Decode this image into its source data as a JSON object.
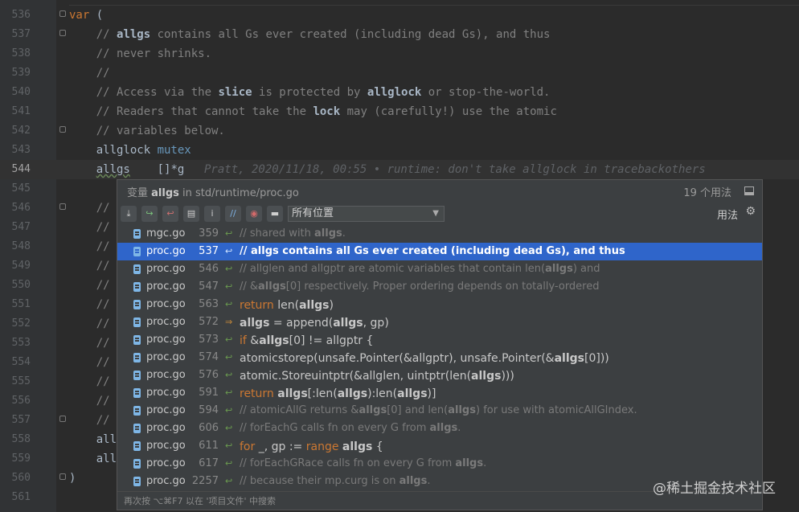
{
  "editor": {
    "lines": [
      {
        "n": "536",
        "code": "var ("
      },
      {
        "n": "537",
        "code": "    // allgs contains all Gs ever created (including dead Gs), and thus"
      },
      {
        "n": "538",
        "code": "    // never shrinks."
      },
      {
        "n": "539",
        "code": "    //"
      },
      {
        "n": "540",
        "code": "    // Access via the slice is protected by allglock or stop-the-world."
      },
      {
        "n": "541",
        "code": "    // Readers that cannot take the lock may (carefully!) use the atomic"
      },
      {
        "n": "542",
        "code": "    // variables below."
      },
      {
        "n": "543",
        "code": "    allglock mutex"
      },
      {
        "n": "544",
        "code": "    allgs    []*g"
      },
      {
        "n": "545",
        "code": ""
      },
      {
        "n": "546",
        "code": "    //"
      },
      {
        "n": "547",
        "code": "    //"
      },
      {
        "n": "548",
        "code": "    //"
      },
      {
        "n": "549",
        "code": "    //"
      },
      {
        "n": "550",
        "code": "    //"
      },
      {
        "n": "551",
        "code": "    //"
      },
      {
        "n": "552",
        "code": "    //"
      },
      {
        "n": "553",
        "code": "    //"
      },
      {
        "n": "554",
        "code": "    //"
      },
      {
        "n": "555",
        "code": "    //"
      },
      {
        "n": "556",
        "code": "    //"
      },
      {
        "n": "557",
        "code": "    //"
      },
      {
        "n": "558",
        "code": "    all"
      },
      {
        "n": "559",
        "code": "    all"
      },
      {
        "n": "560",
        "code": ")"
      },
      {
        "n": "561",
        "code": ""
      }
    ],
    "blame": "Pratt, 2020/11/18, 00:55 • runtime: don't take allglock in tracebackothers"
  },
  "popup": {
    "title_prefix": "变量",
    "title_symbol": "allgs",
    "title_suffix": "in std/runtime/proc.go",
    "count": "19 个用法",
    "scope": "所有位置",
    "usage_label": "用法",
    "toolbar_icons": [
      "expand-icon",
      "next-usage-icon",
      "prev-usage-icon",
      "folder-icon",
      "info-icon",
      "filter-icon",
      "record-icon",
      "preview-icon"
    ],
    "hint": "再次按 ⌥⌘F7 以在 '项目文件' 中搜索",
    "rows": [
      {
        "file": "mgc.go",
        "line": "359",
        "text": "// shared with allgs.",
        "kind": "comment"
      },
      {
        "file": "proc.go",
        "line": "537",
        "text": "// allgs contains all Gs ever created (including dead Gs), and thus",
        "kind": "comment",
        "selected": true
      },
      {
        "file": "proc.go",
        "line": "546",
        "text": "// allglen and allgptr are atomic variables that contain len(allgs) and",
        "kind": "comment"
      },
      {
        "file": "proc.go",
        "line": "547",
        "text": "// &allgs[0] respectively. Proper ordering depends on totally-ordered",
        "kind": "comment"
      },
      {
        "file": "proc.go",
        "line": "563",
        "text": "return len(allgs)",
        "kind": "code"
      },
      {
        "file": "proc.go",
        "line": "572",
        "text": "allgs = append(allgs, gp)",
        "kind": "code",
        "write": true
      },
      {
        "file": "proc.go",
        "line": "573",
        "text": "if &allgs[0] != allgptr {",
        "kind": "code"
      },
      {
        "file": "proc.go",
        "line": "574",
        "text": "atomicstorep(unsafe.Pointer(&allgptr), unsafe.Pointer(&allgs[0]))",
        "kind": "code"
      },
      {
        "file": "proc.go",
        "line": "576",
        "text": "atomic.Storeuintptr(&allglen, uintptr(len(allgs)))",
        "kind": "code"
      },
      {
        "file": "proc.go",
        "line": "591",
        "text": "return allgs[:len(allgs):len(allgs)]",
        "kind": "code"
      },
      {
        "file": "proc.go",
        "line": "594",
        "text": "// atomicAllG returns &allgs[0] and len(allgs) for use with atomicAllGIndex.",
        "kind": "comment"
      },
      {
        "file": "proc.go",
        "line": "606",
        "text": "// forEachG calls fn on every G from allgs.",
        "kind": "comment"
      },
      {
        "file": "proc.go",
        "line": "611",
        "text": "for _, gp := range allgs {",
        "kind": "code"
      },
      {
        "file": "proc.go",
        "line": "617",
        "text": "// forEachGRace calls fn on every G from allgs.",
        "kind": "comment"
      },
      {
        "file": "proc.go",
        "line": "2257",
        "text": "// because their mp.curg is on allgs.",
        "kind": "comment"
      }
    ]
  },
  "watermark": "@稀土掘金技术社区"
}
